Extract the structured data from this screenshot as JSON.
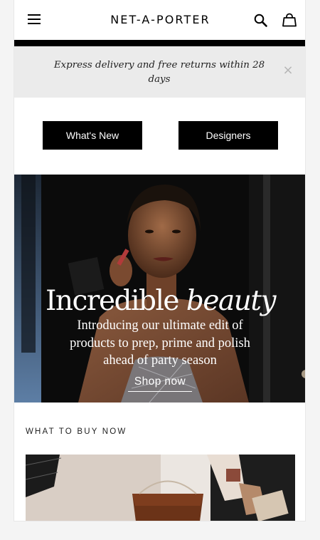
{
  "header": {
    "logo_text": "NET-A-PORTER",
    "menu_icon": "hamburger-menu-icon",
    "search_icon": "search-icon",
    "bag_icon": "shopping-bag-icon"
  },
  "promo": {
    "text": "Express delivery and free returns within 28 days",
    "close_label": "×"
  },
  "quick_nav": {
    "whats_new_label": "What's New",
    "designers_label": "Designers"
  },
  "hero": {
    "title_plain": "Incredible",
    "title_italic": "beauty",
    "subtitle": "Introducing our ultimate edit of products to prep, prime and polish ahead of party season",
    "cta_label": "Shop now"
  },
  "section": {
    "title": "WHAT TO BUY NOW"
  },
  "colors": {
    "accent": "#000000",
    "promo_bg": "#ebebeb",
    "page_bg": "#f4f4f4"
  }
}
